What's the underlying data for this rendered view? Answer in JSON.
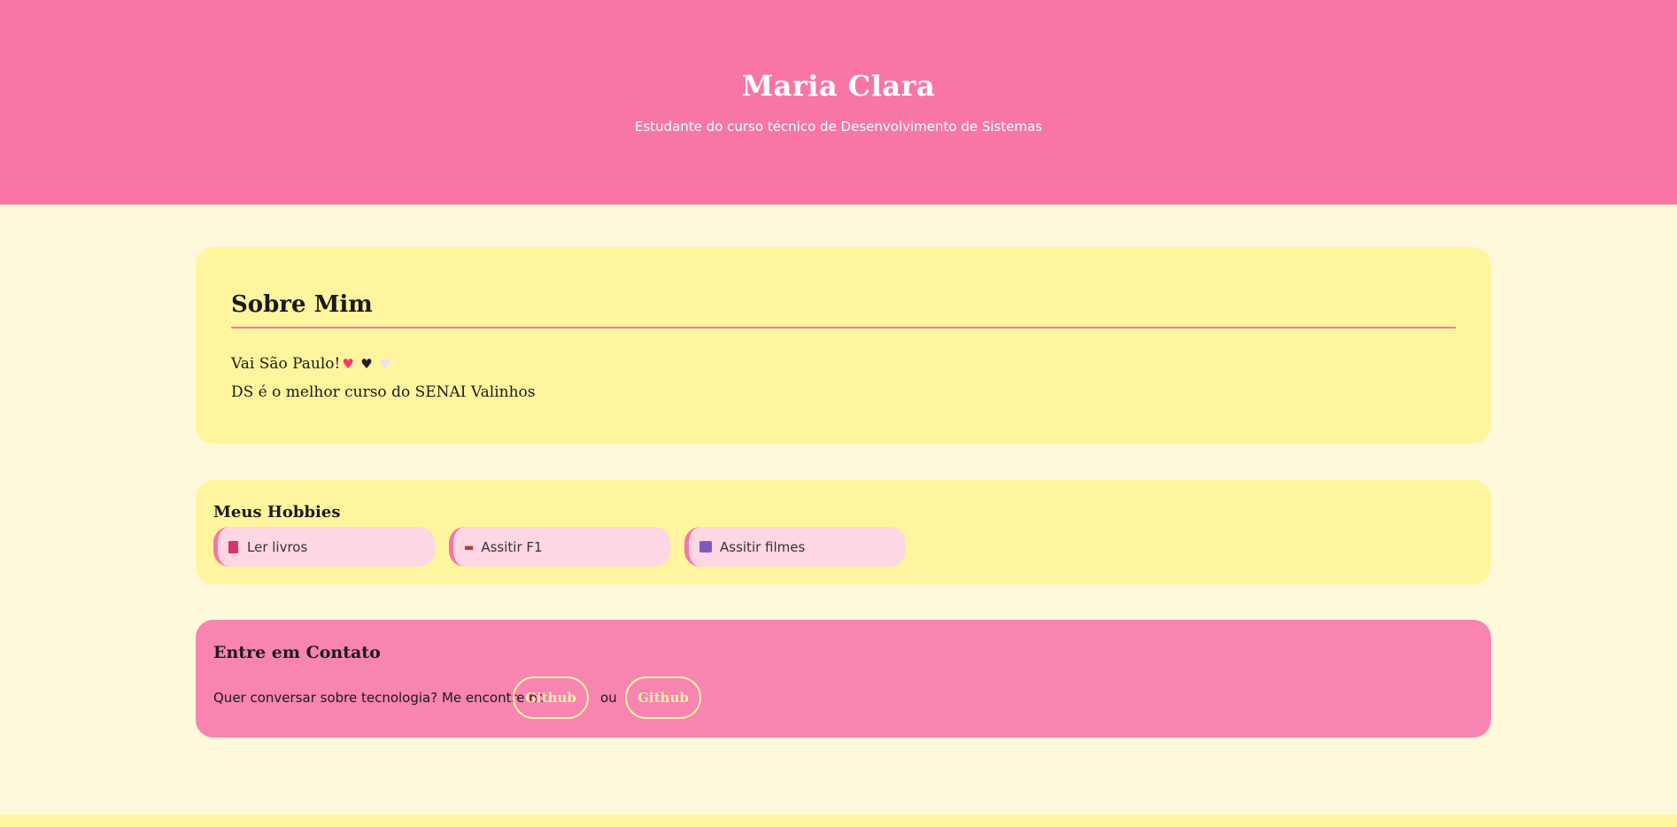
{
  "header": {
    "name": "Maria Clara",
    "subtitle": "Estudante do curso técnico de Desenvolvimento de Sistemas"
  },
  "about": {
    "title": "Sobre Mim",
    "line1_text": "Vai São Paulo!",
    "hearts": [
      "♥",
      "♥",
      "♥"
    ],
    "line2_text": "DS é o melhor curso do SENAI Valinhos"
  },
  "hobbies": {
    "title": "Meus Hobbies",
    "items": [
      {
        "icon": "book-icon",
        "label": "Ler livros"
      },
      {
        "icon": "race-car-icon",
        "label": "Assitir F1"
      },
      {
        "icon": "clapperboard-icon",
        "label": "Assitir filmes"
      }
    ]
  },
  "contact": {
    "title": "Entre em Contato",
    "lead_text": "Quer conversar sobre tecnologia? Me encontre no",
    "link1_label": "Github",
    "separator_text": "ou",
    "link2_label": "Github"
  },
  "colors": {
    "header_bg": "#f776a6",
    "page_bg": "#fef9db",
    "card_yellow": "#fff59e",
    "hobby_pill_bg": "#ffd6e4",
    "contact_bg": "#f884b1",
    "accent_pink": "#f776a6"
  }
}
